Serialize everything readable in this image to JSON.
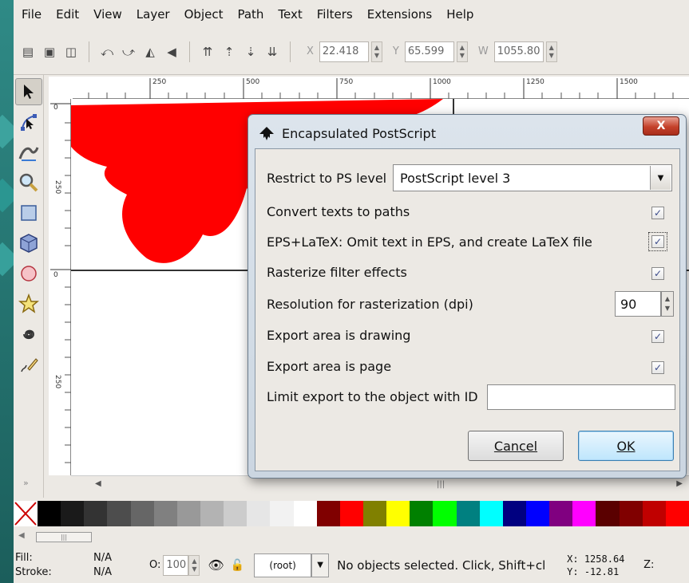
{
  "menubar": {
    "items": [
      "File",
      "Edit",
      "View",
      "Layer",
      "Object",
      "Path",
      "Text",
      "Filters",
      "Extensions",
      "Help"
    ]
  },
  "toolbar": {
    "x_label": "X",
    "x_value": "22.418",
    "y_label": "Y",
    "y_value": "65.599",
    "w_label": "W",
    "w_value": "1055.80"
  },
  "ruler": {
    "h_ticks": [
      "250",
      "500",
      "750",
      "1000",
      "1250",
      "1500"
    ],
    "v_ticks": [
      "0",
      "250",
      "0",
      "250"
    ]
  },
  "dialog": {
    "title": "Encapsulated PostScript",
    "close_label": "X",
    "ps_level_label": "Restrict to PS level",
    "ps_level_value": "PostScript level 3",
    "convert_text_label": "Convert texts to paths",
    "convert_text_checked": true,
    "latex_label": "EPS+LaTeX: Omit text in EPS, and create LaTeX file",
    "latex_checked": true,
    "rasterize_label": "Rasterize filter effects",
    "rasterize_checked": true,
    "resolution_label": "Resolution for rasterization (dpi)",
    "resolution_value": "90",
    "area_drawing_label": "Export area is drawing",
    "area_drawing_checked": true,
    "area_page_label": "Export area is page",
    "area_page_checked": true,
    "limit_id_label": "Limit export to the object with ID",
    "limit_id_value": "",
    "cancel_label": "Cancel",
    "ok_label": "OK"
  },
  "palette": {
    "colors": [
      "#000000",
      "#1a1a1a",
      "#333333",
      "#4d4d4d",
      "#666666",
      "#808080",
      "#999999",
      "#b3b3b3",
      "#cccccc",
      "#e6e6e6",
      "#f2f2f2",
      "#ffffff",
      "#800000",
      "#ff0000",
      "#808000",
      "#ffff00",
      "#008000",
      "#00ff00",
      "#008080",
      "#00ffff",
      "#000080",
      "#0000ff",
      "#800080",
      "#ff00ff",
      "#5a0000",
      "#800000",
      "#c00000",
      "#ff0000"
    ]
  },
  "status": {
    "fill_label": "Fill:",
    "stroke_label": "Stroke:",
    "fill_value": "N/A",
    "stroke_value": "N/A",
    "opacity_label": "O:",
    "opacity_value": "100",
    "layer_value": "(root)",
    "message": "No objects selected. Click, Shift+cl",
    "cursor_x": "X: 1258.64",
    "cursor_y": "Y:  -12.81",
    "zoom_label": "Z:"
  },
  "colors": {
    "drawing_red": "#ff0000",
    "dialog_frame": "#cbd6e1",
    "close_button": "#c4412b"
  }
}
